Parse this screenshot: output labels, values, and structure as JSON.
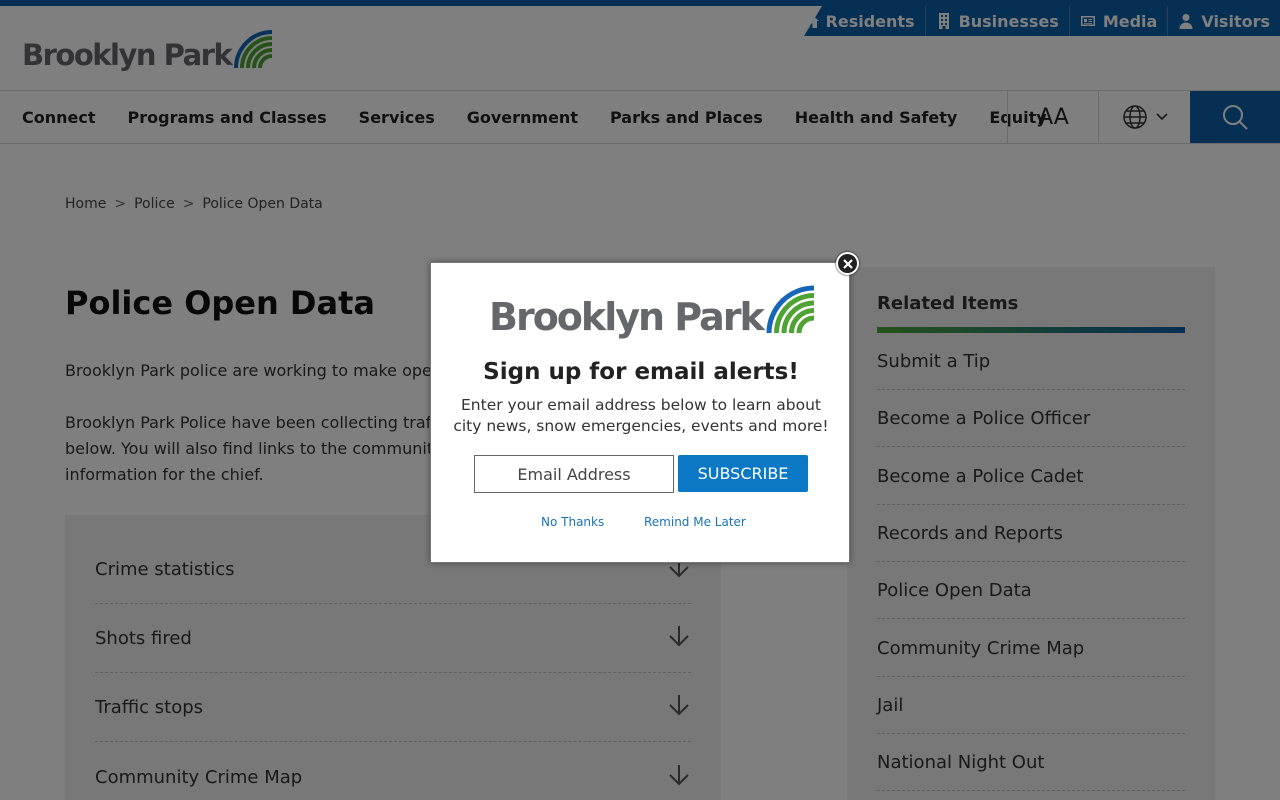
{
  "brand": {
    "name": "Brooklyn Park",
    "accent": "#0c5ea8",
    "green": "#4ea334"
  },
  "audience_nav": [
    {
      "label": "Residents",
      "icon": "home-icon"
    },
    {
      "label": "Businesses",
      "icon": "building-icon"
    },
    {
      "label": "Media",
      "icon": "newspaper-icon"
    },
    {
      "label": "Visitors",
      "icon": "person-icon"
    }
  ],
  "main_nav": [
    "Connect",
    "Programs and Classes",
    "Services",
    "Government",
    "Parks and Places",
    "Health and Safety",
    "Equity"
  ],
  "tools": {
    "text_size": "AA",
    "language_icon": "globe-icon",
    "search_icon": "search-icon"
  },
  "breadcrumb": [
    "Home",
    "Police",
    "Police Open Data"
  ],
  "breadcrumb_sep": ">",
  "page": {
    "title": "Police Open Data",
    "para1": "Brooklyn Park police are working to make open d",
    "para2_lines": [
      "Brooklyn Park Police have been collecting traffic s",
      "below. You will also find links to the community c",
      "information for the chief."
    ]
  },
  "accordion": [
    "Crime statistics",
    "Shots fired",
    "Traffic stops",
    "Community Crime Map"
  ],
  "sidebar": {
    "title": "Related Items",
    "items": [
      "Submit a Tip",
      "Become a Police Officer",
      "Become a Police Cadet",
      "Records and Reports",
      "Police Open Data",
      "Community Crime Map",
      "Jail",
      "National Night Out"
    ]
  },
  "modal": {
    "title": "Sign up for email alerts!",
    "desc": "Enter your email address below to learn about city news, snow emergencies, events and more!",
    "email_placeholder": "Email Address",
    "subscribe_label": "SUBSCRIBE",
    "no_thanks": "No Thanks",
    "remind_later": "Remind Me Later"
  }
}
